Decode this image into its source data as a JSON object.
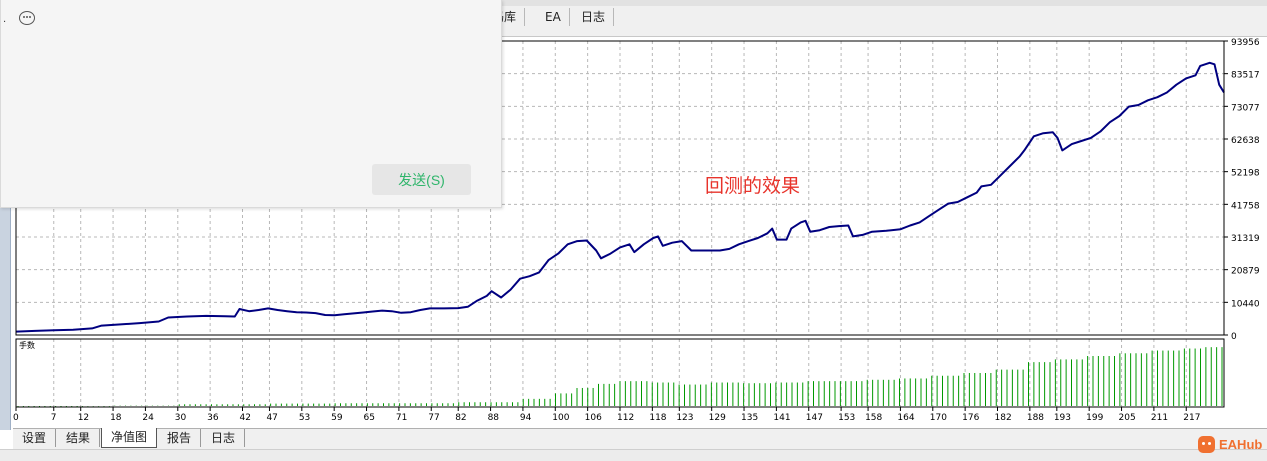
{
  "window": {
    "top_tabs": [
      "码库",
      "EA",
      "日志"
    ]
  },
  "chat": {
    "send_label": "发送(S)"
  },
  "bottom_tabs": [
    {
      "label": "设置",
      "active": false
    },
    {
      "label": "结果",
      "active": false
    },
    {
      "label": "净值图",
      "active": true
    },
    {
      "label": "报告",
      "active": false
    },
    {
      "label": "日志",
      "active": false
    }
  ],
  "logo": {
    "text": "EAHub"
  },
  "colors": {
    "equity_line": "#000080",
    "volume_bar": "#009900",
    "annotation": "#e8332b",
    "grid": "#b8b8b8"
  },
  "chart_data": [
    {
      "type": "line",
      "annotation": "回测的效果",
      "ylim": [
        0,
        93956
      ],
      "yticks": [
        0,
        10440,
        20879,
        31319,
        41758,
        52198,
        62638,
        73077,
        83517,
        93956
      ],
      "xlim": [
        0,
        224
      ],
      "xticks": [
        0,
        7,
        12,
        18,
        24,
        30,
        36,
        42,
        47,
        53,
        59,
        65,
        71,
        77,
        82,
        88,
        94,
        100,
        106,
        112,
        118,
        123,
        129,
        135,
        141,
        147,
        153,
        158,
        164,
        170,
        176,
        182,
        188,
        193,
        199,
        205,
        211,
        217
      ],
      "grid": true,
      "series": [
        {
          "points": [
            [
              0,
              1100
            ],
            [
              4,
              1300
            ],
            [
              8,
              1500
            ],
            [
              12,
              1700
            ],
            [
              16,
              2100
            ],
            [
              18,
              3000
            ],
            [
              22,
              3400
            ],
            [
              26,
              3800
            ],
            [
              30,
              4300
            ],
            [
              32,
              5600
            ],
            [
              36,
              5900
            ],
            [
              40,
              6100
            ],
            [
              44,
              6000
            ],
            [
              46,
              5900
            ],
            [
              47,
              8300
            ],
            [
              49,
              7600
            ],
            [
              51,
              8000
            ],
            [
              53,
              8500
            ],
            [
              55,
              8000
            ],
            [
              57,
              7600
            ],
            [
              59,
              7300
            ],
            [
              61,
              7200
            ],
            [
              63,
              7000
            ],
            [
              65,
              6400
            ],
            [
              67,
              6300
            ],
            [
              69,
              6600
            ],
            [
              71,
              6900
            ],
            [
              73,
              7200
            ],
            [
              75,
              7500
            ],
            [
              77,
              7800
            ],
            [
              79,
              7600
            ],
            [
              81,
              7100
            ],
            [
              83,
              7300
            ],
            [
              85,
              8000
            ],
            [
              87,
              8500
            ],
            [
              90,
              8500
            ],
            [
              93,
              8600
            ],
            [
              95,
              9000
            ],
            [
              97,
              11000
            ],
            [
              99,
              12500
            ],
            [
              100,
              14000
            ],
            [
              102,
              12000
            ],
            [
              104,
              14500
            ],
            [
              106,
              18000
            ],
            [
              108,
              18800
            ],
            [
              110,
              20000
            ],
            [
              112,
              24000
            ],
            [
              114,
              26000
            ],
            [
              116,
              29000
            ],
            [
              118,
              30000
            ],
            [
              120,
              30200
            ],
            [
              122,
              27000
            ],
            [
              123,
              24500
            ],
            [
              125,
              26000
            ],
            [
              127,
              28000
            ],
            [
              129,
              29000
            ],
            [
              130,
              26500
            ],
            [
              132,
              29000
            ],
            [
              134,
              31000
            ],
            [
              135,
              31500
            ],
            [
              136,
              28500
            ],
            [
              138,
              29500
            ],
            [
              140,
              30000
            ],
            [
              142,
              27000
            ],
            [
              145,
              27000
            ],
            [
              148,
              27000
            ],
            [
              150,
              27500
            ],
            [
              152,
              29000
            ],
            [
              154,
              30000
            ],
            [
              156,
              31000
            ],
            [
              158,
              32500
            ],
            [
              159,
              34000
            ],
            [
              160,
              30500
            ],
            [
              162,
              30500
            ],
            [
              163,
              34000
            ],
            [
              165,
              36000
            ],
            [
              166,
              36500
            ],
            [
              167,
              33000
            ],
            [
              169,
              33500
            ],
            [
              171,
              34500
            ],
            [
              173,
              34800
            ],
            [
              175,
              35000
            ],
            [
              176,
              31500
            ],
            [
              178,
              32000
            ],
            [
              180,
              33000
            ],
            [
              183,
              33300
            ],
            [
              186,
              33800
            ],
            [
              188,
              35000
            ],
            [
              190,
              36000
            ],
            [
              192,
              38000
            ],
            [
              194,
              40000
            ],
            [
              196,
              42000
            ],
            [
              198,
              42500
            ],
            [
              200,
              44000
            ],
            [
              202,
              45500
            ],
            [
              203,
              47500
            ],
            [
              205,
              48000
            ],
            [
              207,
              51000
            ],
            [
              209,
              54000
            ],
            [
              211,
              57000
            ],
            [
              212,
              59000
            ],
            [
              214,
              63500
            ],
            [
              216,
              64500
            ],
            [
              218,
              64800
            ],
            [
              219,
              63000
            ],
            [
              220,
              59000
            ],
            [
              222,
              61000
            ],
            [
              224,
              62000
            ],
            [
              226,
              63000
            ],
            [
              228,
              65000
            ],
            [
              230,
              68000
            ],
            [
              232,
              70000
            ],
            [
              234,
              73000
            ],
            [
              236,
              73500
            ],
            [
              238,
              75000
            ],
            [
              240,
              76000
            ],
            [
              242,
              77500
            ],
            [
              244,
              80000
            ],
            [
              246,
              82000
            ],
            [
              248,
              83000
            ],
            [
              249,
              86000
            ],
            [
              251,
              87000
            ],
            [
              252,
              86500
            ],
            [
              253,
              80000
            ],
            [
              254,
              77500
            ]
          ]
        }
      ]
    },
    {
      "type": "bar",
      "title": "手数",
      "xlim": [
        0,
        224
      ],
      "ylim": [
        0,
        1
      ],
      "steps": [
        [
          0,
          0.004
        ],
        [
          12,
          0.01
        ],
        [
          18,
          0.02
        ],
        [
          30,
          0.04
        ],
        [
          47,
          0.05
        ],
        [
          59,
          0.055
        ],
        [
          82,
          0.07
        ],
        [
          94,
          0.12
        ],
        [
          100,
          0.2
        ],
        [
          104,
          0.28
        ],
        [
          108,
          0.34
        ],
        [
          112,
          0.38
        ],
        [
          118,
          0.36
        ],
        [
          123,
          0.33
        ],
        [
          129,
          0.36
        ],
        [
          135,
          0.35
        ],
        [
          141,
          0.36
        ],
        [
          147,
          0.38
        ],
        [
          153,
          0.38
        ],
        [
          158,
          0.4
        ],
        [
          164,
          0.42
        ],
        [
          170,
          0.46
        ],
        [
          176,
          0.5
        ],
        [
          182,
          0.55
        ],
        [
          188,
          0.66
        ],
        [
          193,
          0.7
        ],
        [
          199,
          0.75
        ],
        [
          205,
          0.79
        ],
        [
          211,
          0.83
        ],
        [
          217,
          0.86
        ],
        [
          221,
          0.88
        ]
      ]
    }
  ]
}
